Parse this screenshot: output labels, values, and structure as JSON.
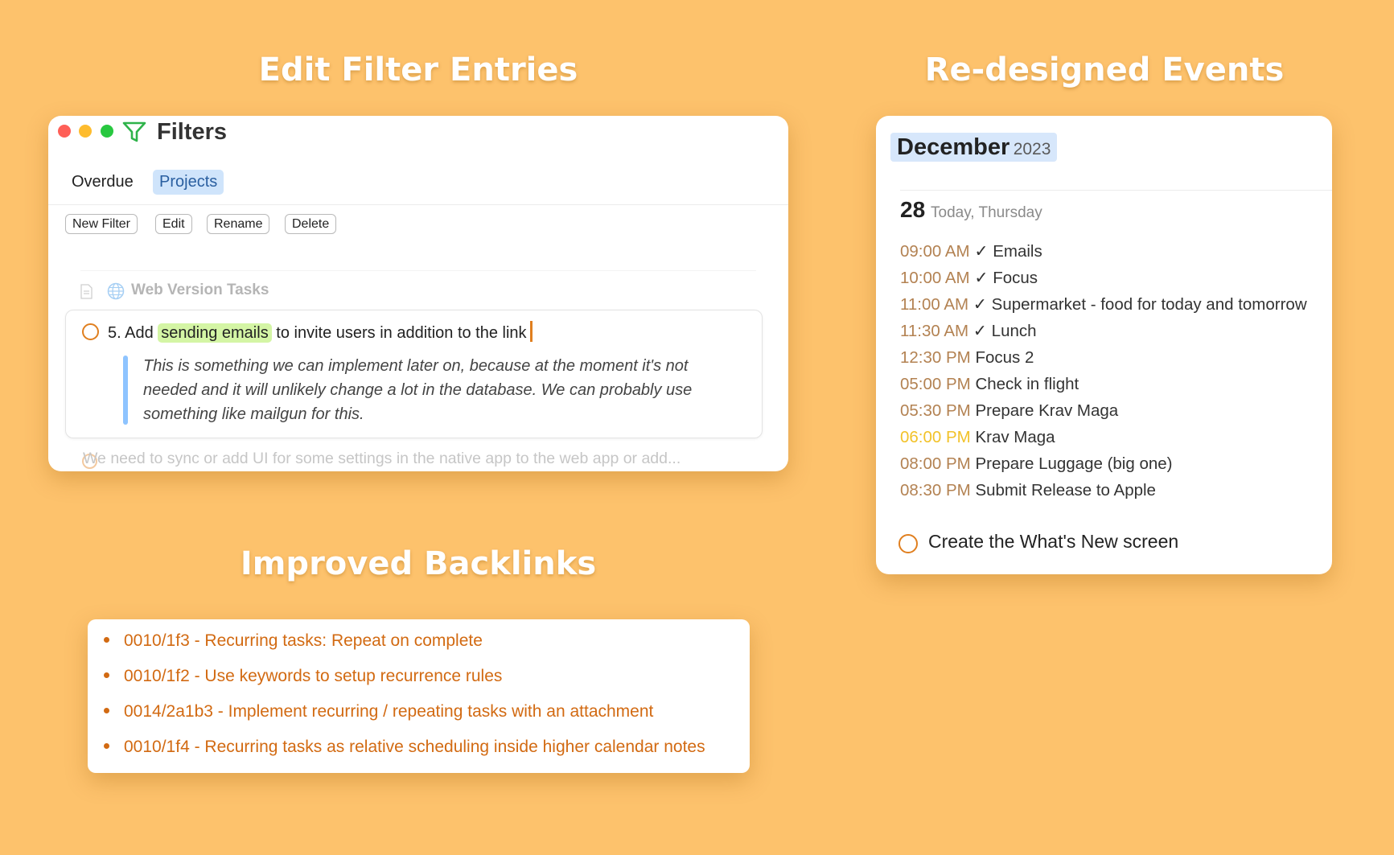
{
  "headings": {
    "filters": "Edit Filter Entries",
    "events": "Re-designed Events",
    "backlinks": "Improved Backlinks"
  },
  "filters_window": {
    "title": "Filters",
    "tabs": [
      "Overdue",
      "Projects"
    ],
    "active_tab": "Projects",
    "buttons": {
      "new_filter": "New Filter",
      "edit": "Edit",
      "rename": "Rename",
      "delete": "Delete"
    },
    "section_title": "Web Version Tasks",
    "task": {
      "prefix": "5. Add",
      "highlight": "sending emails",
      "suffix": "to invite users in addition to the link",
      "quote": "This is something we can implement later on, because at the moment it's not needed and it will unlikely change a lot in the database. We can probably use something like mailgun for this."
    },
    "next_task": "We need to sync or add UI for some settings in the native app to the web app or add..."
  },
  "events_card": {
    "month": "December",
    "year": "2023",
    "day": "28",
    "day_label": "Today, Thursday",
    "events": [
      {
        "time": "09:00 AM",
        "title": "✓ Emails"
      },
      {
        "time": "10:00 AM",
        "title": "✓ Focus"
      },
      {
        "time": "11:00 AM",
        "title": "✓ Supermarket - food for today and tomorrow"
      },
      {
        "time": "11:30 AM",
        "title": "✓ Lunch"
      },
      {
        "time": "12:30 PM",
        "title": "Focus 2"
      },
      {
        "time": "05:00 PM",
        "title": "Check in flight"
      },
      {
        "time": "05:30 PM",
        "title": "Prepare Krav Maga"
      },
      {
        "time": "06:00 PM",
        "title": "Krav Maga",
        "current": true
      },
      {
        "time": "08:00 PM",
        "title": "Prepare Luggage (big one)"
      },
      {
        "time": "08:30 PM",
        "title": "Submit Release to Apple"
      }
    ],
    "task": "Create the What's New screen"
  },
  "backlinks": [
    "0010/1f3 - Recurring tasks: Repeat on complete",
    "0010/1f2 - Use keywords to setup recurrence rules",
    "0014/2a1b3 - Implement recurring / repeating tasks with an attachment",
    "0010/1f4 - Recurring tasks as relative scheduling inside higher calendar notes"
  ],
  "colors": {
    "background": "#fdc26c",
    "accent": "#e07f1f",
    "link": "#d26a12",
    "highlight": "#d4f5a5",
    "active_tab": "#cfe4fb",
    "current_time": "#f2c229"
  }
}
